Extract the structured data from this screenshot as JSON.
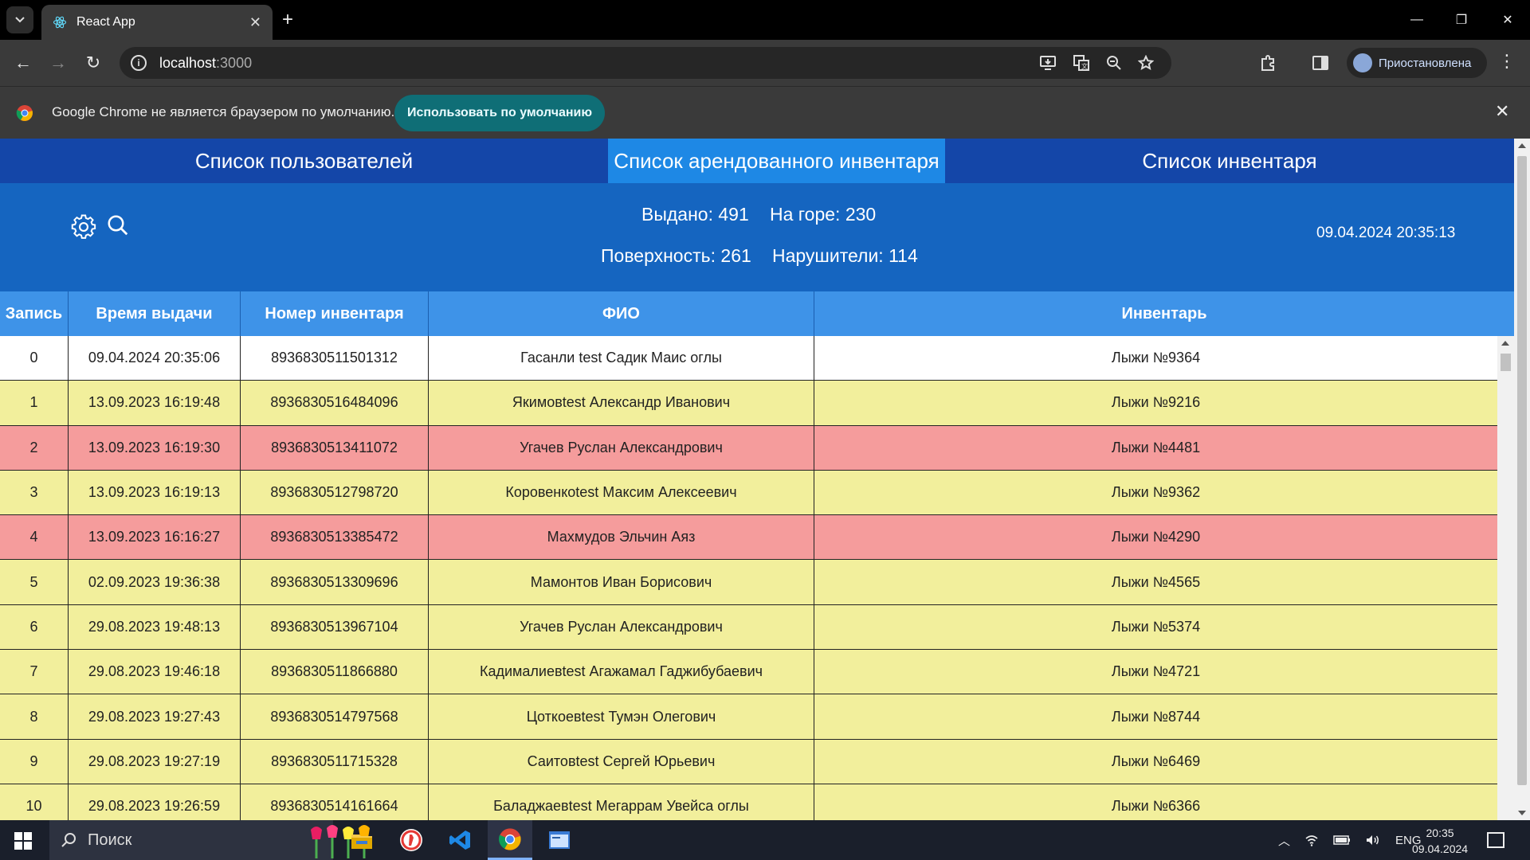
{
  "browser": {
    "tab_title": "React App",
    "url_host": "localhost",
    "url_port": ":3000",
    "profile_status": "Приостановлена",
    "infobar_text": "Google Chrome не является браузером по умолчанию.",
    "infobar_button": "Использовать по умолчанию",
    "accent_color": "#0f6e76"
  },
  "nav": {
    "tabs": [
      {
        "label": "Список пользователей",
        "active": false
      },
      {
        "label": "Список арендованного инвентаря",
        "active": true
      },
      {
        "label": "Список инвентаря",
        "active": false
      }
    ]
  },
  "stats": {
    "issued": "Выдано: 491",
    "on_mountain": "На горе: 230",
    "surface": "Поверхность: 261",
    "violators": "Нарушители: 114",
    "datetime": "09.04.2024 20:35:13",
    "icons": [
      "gear-icon",
      "search-icon"
    ]
  },
  "table": {
    "headers": [
      "Запись",
      "Время выдачи",
      "Номер инвентаря",
      "ФИО",
      "Инвентарь"
    ],
    "row_colors": {
      "white": "#ffffff",
      "yellow": "#f2ef9c",
      "red": "#f59c9c"
    },
    "rows": [
      {
        "record": "0",
        "time": "09.04.2024 20:35:06",
        "number": "8936830511501312",
        "name": "Гасанли test Садик Маис оглы",
        "item": "Лыжи №9364",
        "status": "white"
      },
      {
        "record": "1",
        "time": "13.09.2023 16:19:48",
        "number": "8936830516484096",
        "name": "Якимовtest Александр Иванович",
        "item": "Лыжи №9216",
        "status": "yellow"
      },
      {
        "record": "2",
        "time": "13.09.2023 16:19:30",
        "number": "8936830513411072",
        "name": "Угачев Руслан Александрович",
        "item": "Лыжи №4481",
        "status": "red"
      },
      {
        "record": "3",
        "time": "13.09.2023 16:19:13",
        "number": "8936830512798720",
        "name": "Коровенкоtest Максим Алексеевич",
        "item": "Лыжи №9362",
        "status": "yellow"
      },
      {
        "record": "4",
        "time": "13.09.2023 16:16:27",
        "number": "8936830513385472",
        "name": "Махмудов Эльчин Аяз",
        "item": "Лыжи №4290",
        "status": "red"
      },
      {
        "record": "5",
        "time": "02.09.2023 19:36:38",
        "number": "8936830513309696",
        "name": "Мамонтов Иван Борисович",
        "item": "Лыжи №4565",
        "status": "yellow"
      },
      {
        "record": "6",
        "time": "29.08.2023 19:48:13",
        "number": "8936830513967104",
        "name": "Угачев Руслан Александрович",
        "item": "Лыжи №5374",
        "status": "yellow"
      },
      {
        "record": "7",
        "time": "29.08.2023 19:46:18",
        "number": "8936830511866880",
        "name": "Кадималиевtest Агажамал Гаджибубаевич",
        "item": "Лыжи №4721",
        "status": "yellow"
      },
      {
        "record": "8",
        "time": "29.08.2023 19:27:43",
        "number": "8936830514797568",
        "name": "Цоткоевtest Тумэн Олегович",
        "item": "Лыжи №8744",
        "status": "yellow"
      },
      {
        "record": "9",
        "time": "29.08.2023 19:27:19",
        "number": "8936830511715328",
        "name": "Саитовtest Сергей Юрьевич",
        "item": "Лыжи №6469",
        "status": "yellow"
      },
      {
        "record": "10",
        "time": "29.08.2023 19:26:59",
        "number": "8936830514161664",
        "name": "Баладжаевtest Мегаррам Увейса оглы",
        "item": "Лыжи №6366",
        "status": "yellow"
      }
    ]
  },
  "taskbar": {
    "search_label": "Поиск",
    "language": "ENG",
    "clock_time": "20:35",
    "clock_date": "09.04.2024"
  }
}
